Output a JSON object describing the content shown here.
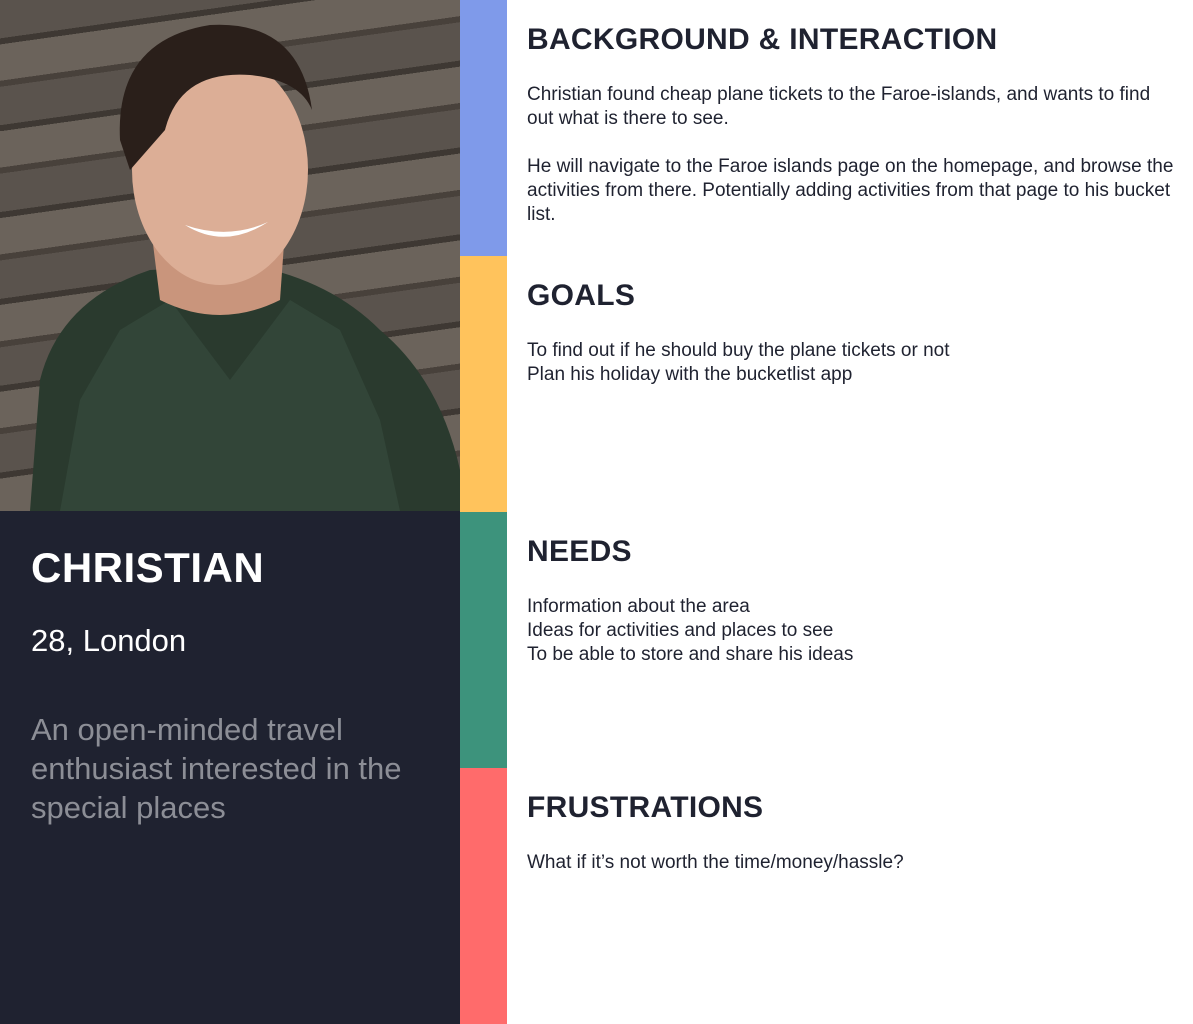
{
  "persona": {
    "name": "CHRISTIAN",
    "age_location": "28, London",
    "bio": "An open-minded travel enthusiast interested in the special places"
  },
  "colors": {
    "background_interaction": "#7f9aea",
    "goals": "#ffc35c",
    "needs": "#3d937c",
    "frustrations": "#ff6b6b",
    "dark_panel": "#1f2230"
  },
  "sections": [
    {
      "title": "BACKGROUND & INTERACTION",
      "body": "Christian found cheap plane tickets to the Faroe-islands, and wants to find out what is there to see.\n\nHe will navigate to the Faroe islands page on the homepage, and browse the activities from there. Potentially adding activities from that page to his bucket list."
    },
    {
      "title": "GOALS",
      "body": "To find out if he should buy the plane tickets or not\nPlan his holiday with the bucketlist app"
    },
    {
      "title": "NEEDS",
      "body": "Information about the area\nIdeas for activities and places to see\nTo be able to store and share his ideas"
    },
    {
      "title": "FRUSTRATIONS",
      "body": "What if it’s not worth the time/money/hassle?"
    }
  ]
}
